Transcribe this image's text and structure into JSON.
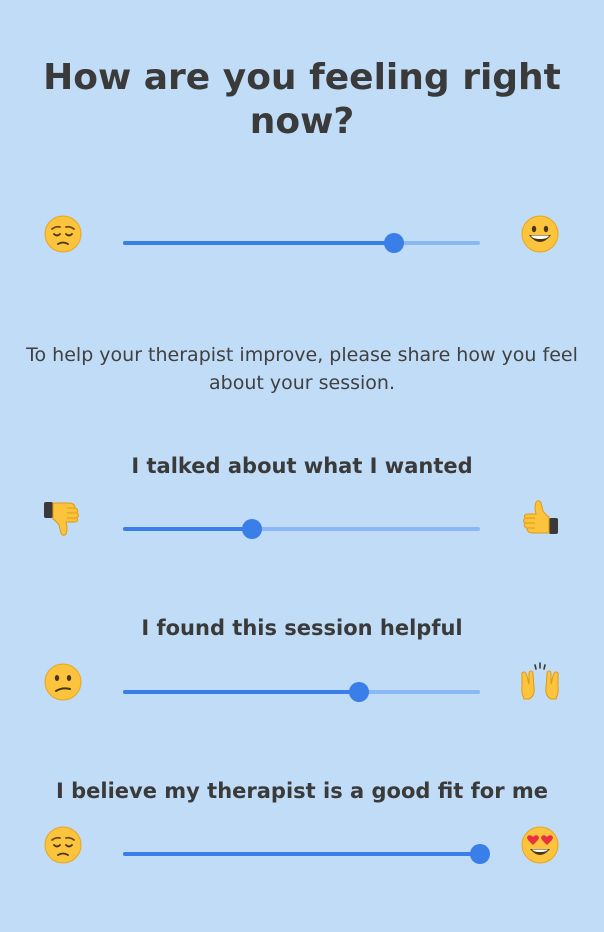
{
  "title": "How are you feeling right now?",
  "intro": "To help your therapist improve, please share how you feel about your session.",
  "mood": {
    "left_icon": "pensive-face-icon",
    "right_icon": "grinning-face-icon",
    "value": 0.76
  },
  "questions": [
    {
      "label": "I talked about what I wanted",
      "left_icon": "thumbs-down-icon",
      "right_icon": "thumbs-up-icon",
      "value": 0.36
    },
    {
      "label": "I found this session helpful",
      "left_icon": "confused-face-icon",
      "right_icon": "raising-hands-icon",
      "value": 0.66
    },
    {
      "label": "I believe my therapist is a good fit for me",
      "left_icon": "pensive-face-icon",
      "right_icon": "heart-eyes-face-icon",
      "value": 1.0
    }
  ],
  "colors": {
    "background": "#c0dcf6",
    "slider_active": "#3a7ee9",
    "slider_inactive": "#8ab8f4"
  }
}
